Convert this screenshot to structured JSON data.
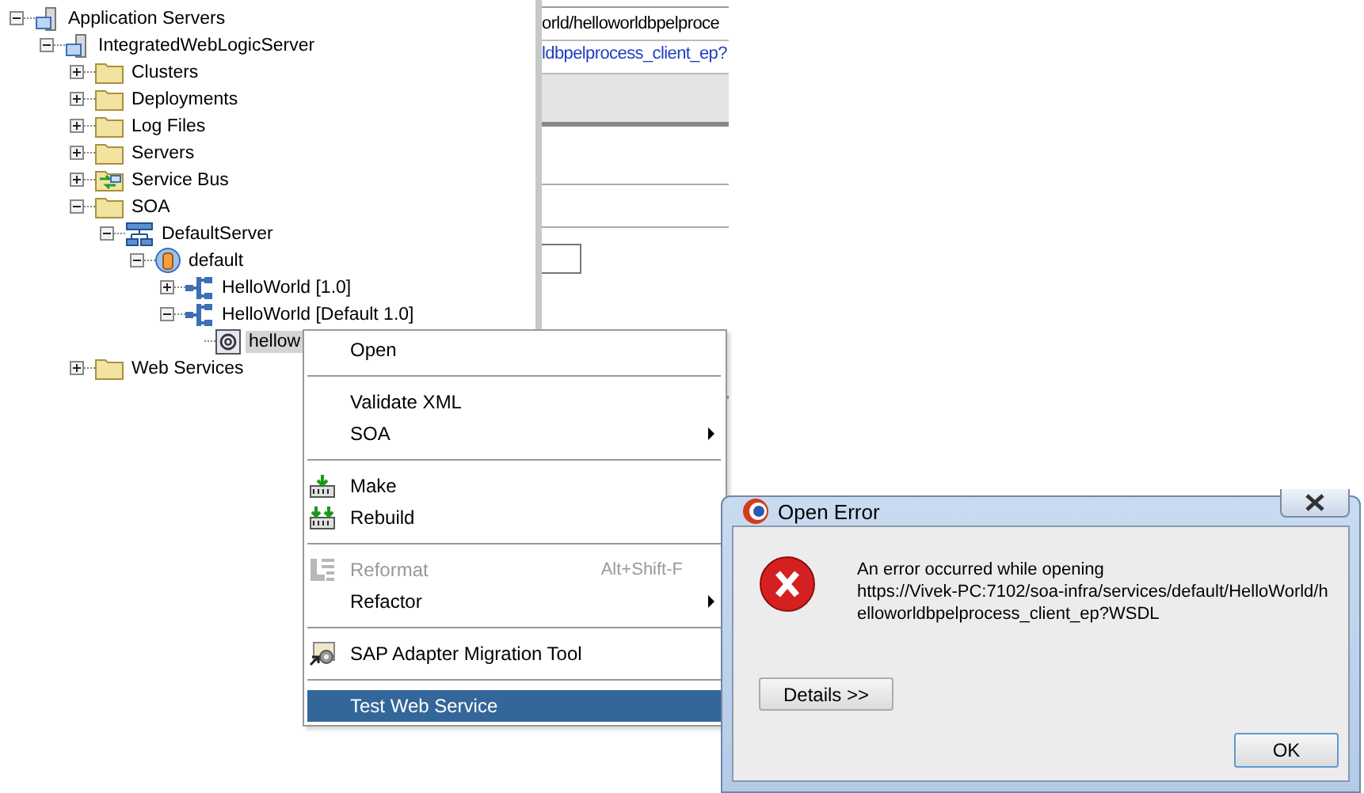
{
  "tree": [
    {
      "label": "Application Servers",
      "kind": "server-group",
      "expanded": true,
      "selected": false,
      "children": [
        {
          "label": "IntegratedWebLogicServer",
          "kind": "server",
          "expanded": true,
          "selected": false,
          "children": [
            {
              "label": "Clusters",
              "kind": "folder",
              "expanded": false,
              "selected": false
            },
            {
              "label": "Deployments",
              "kind": "folder",
              "expanded": false,
              "selected": false
            },
            {
              "label": "Log Files",
              "kind": "folder",
              "expanded": false,
              "selected": false
            },
            {
              "label": "Servers",
              "kind": "folder",
              "expanded": false,
              "selected": false
            },
            {
              "label": "Service Bus",
              "kind": "bus",
              "expanded": false,
              "selected": false
            },
            {
              "label": "SOA",
              "kind": "folder",
              "expanded": true,
              "selected": false,
              "children": [
                {
                  "label": "DefaultServer",
                  "kind": "network",
                  "expanded": true,
                  "selected": false,
                  "children": [
                    {
                      "label": "default",
                      "kind": "partition",
                      "expanded": true,
                      "selected": false,
                      "children": [
                        {
                          "label": "HelloWorld [1.0]",
                          "kind": "composite",
                          "expanded": false,
                          "selected": false
                        },
                        {
                          "label": "HelloWorld [Default 1.0]",
                          "kind": "composite",
                          "expanded": true,
                          "selected": false,
                          "children": [
                            {
                              "label": "hellow",
                              "kind": "service",
                              "selected": true
                            }
                          ]
                        }
                      ]
                    }
                  ]
                }
              ]
            },
            {
              "label": "Web Services",
              "kind": "folder",
              "expanded": false,
              "selected": false
            }
          ]
        }
      ]
    }
  ],
  "background_window": {
    "url_lines": [
      "orld/helloworldbpelproce",
      "ldbpelprocess_client_ep?"
    ]
  },
  "context_menu": {
    "items": [
      {
        "kind": "command",
        "label": "Open",
        "disabled": false,
        "selected": false
      },
      {
        "kind": "separator"
      },
      {
        "kind": "command",
        "label": "Validate XML",
        "disabled": false,
        "selected": false
      },
      {
        "kind": "submenu",
        "label": "SOA",
        "disabled": false,
        "selected": false
      },
      {
        "kind": "separator"
      },
      {
        "kind": "command",
        "label": "Make",
        "disabled": false,
        "selected": false
      },
      {
        "kind": "command",
        "label": "Rebuild",
        "disabled": false,
        "selected": false
      },
      {
        "kind": "separator"
      },
      {
        "kind": "command",
        "label": "Reformat",
        "shortcut": "Alt+Shift-F",
        "disabled": true,
        "selected": false
      },
      {
        "kind": "submenu",
        "label": "Refactor",
        "disabled": false,
        "selected": false
      },
      {
        "kind": "separator"
      },
      {
        "kind": "command",
        "label": "SAP Adapter Migration Tool",
        "disabled": false,
        "selected": false
      },
      {
        "kind": "separator"
      },
      {
        "kind": "command",
        "label": "Test Web Service",
        "disabled": false,
        "selected": true
      }
    ]
  },
  "dialog": {
    "title": "Open Error",
    "message_lines": [
      "An error occurred while opening",
      "https://Vivek-PC:7102/soa-infra/services/default/HelloWorld/h",
      "elloworldbpelprocess_client_ep?WSDL"
    ],
    "buttons": [
      "Details >>",
      "OK"
    ]
  }
}
